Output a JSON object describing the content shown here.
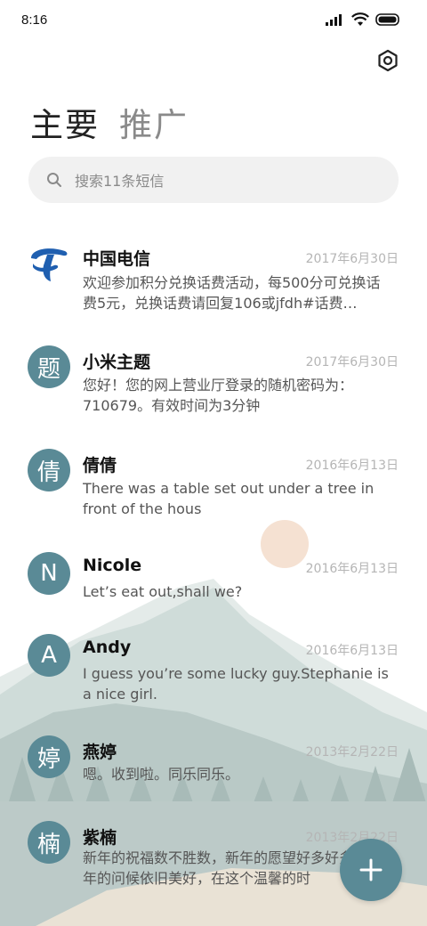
{
  "status_bar": {
    "time": "8:16"
  },
  "tabs": [
    {
      "label": "主要",
      "active": true
    },
    {
      "label": "推广",
      "active": false
    }
  ],
  "search": {
    "placeholder": "搜索11条短信"
  },
  "accent_color": "#5a8a96",
  "conversations": [
    {
      "name": "中国电信",
      "date": "2017年6月30日",
      "avatar": "china-telecom-logo",
      "preview": "欢迎参加积分兑换话费活动，每500分可兑换话费5元，兑换话费请回复106或jfdh#话费…"
    },
    {
      "name": "小米主题",
      "date": "2017年6月30日",
      "avatar": "题",
      "preview": "您好！您的网上营业厅登录的随机密码为：710679。有效时间为3分钟"
    },
    {
      "name": "倩倩",
      "date": "2016年6月13日",
      "avatar": "倩",
      "preview": "There was a table set out under a tree in front of the hous"
    },
    {
      "name": "Nicole",
      "date": "2016年6月13日",
      "avatar": "N",
      "preview": "Let’s eat out,shall we?"
    },
    {
      "name": "Andy",
      "date": "2016年6月13日",
      "avatar": "A",
      "preview": "I guess you’re some lucky guy.Stephanie is a nice girl."
    },
    {
      "name": "燕婷",
      "date": "2013年2月22日",
      "avatar": "婷",
      "preview": "嗯。收到啦。同乐同乐。"
    },
    {
      "name": "紫楠",
      "date": "2013年2月22日",
      "avatar": "楠",
      "preview": "新年的祝福数不胜数，新年的愿望好多好多，新年的问候依旧美好，在这个温馨的时"
    }
  ]
}
